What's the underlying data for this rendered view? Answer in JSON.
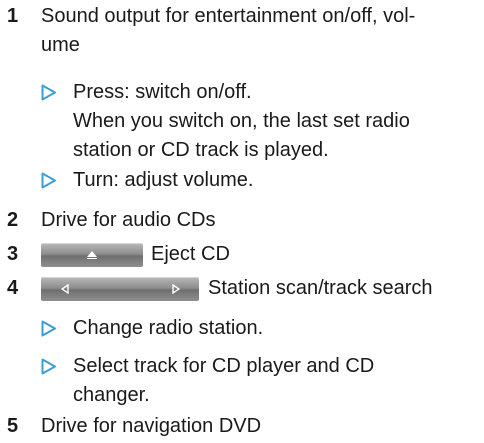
{
  "accent": "#3a9fd6",
  "items": [
    {
      "number": "1",
      "lines": [
        "Sound output for entertainment on/off, vol-",
        "ume"
      ],
      "subitems": [
        {
          "lines": [
            "Press: switch on/off.",
            "When you switch on, the last set radio",
            "station or CD track is played."
          ]
        },
        {
          "lines": [
            "Turn: adjust volume."
          ]
        }
      ]
    },
    {
      "number": "2",
      "lines": [
        "Drive for audio CDs"
      ]
    },
    {
      "number": "3",
      "button_icon": "eject-button-icon",
      "text": "Eject CD"
    },
    {
      "number": "4",
      "button_icon": "seek-left-right-button-icon",
      "text": "Station scan/track search",
      "subitems": [
        {
          "lines": [
            "Change radio station."
          ]
        },
        {
          "lines": [
            "Select track for CD player and CD",
            "changer."
          ]
        }
      ]
    },
    {
      "number": "5",
      "lines": [
        "Drive for navigation DVD"
      ]
    }
  ]
}
